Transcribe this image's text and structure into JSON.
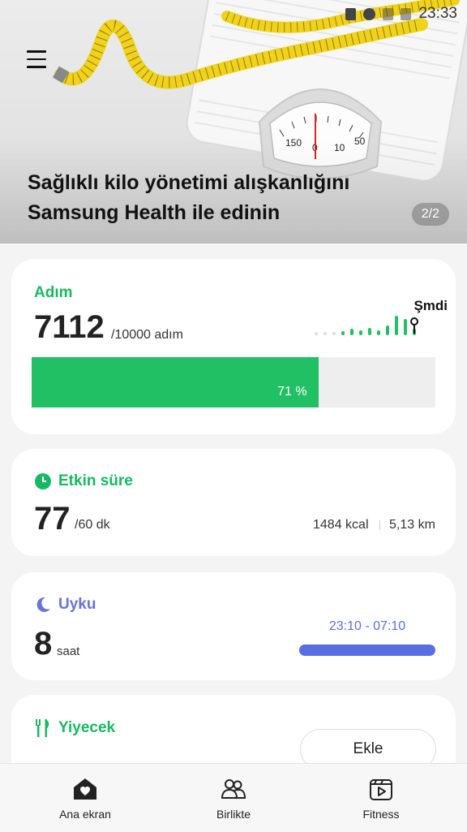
{
  "status_bar": {
    "time": "23:33"
  },
  "banner": {
    "title": "Sağlıklı kilo yönetimi alışkanlığını Samsung Health ile edinin",
    "pager": "2/2"
  },
  "steps": {
    "label": "Adım",
    "value": "7112",
    "goal": "/10000 adım",
    "now_label": "Şmdi",
    "progress_text": "71 %",
    "progress_percent": 71,
    "accent": "#22c064"
  },
  "active": {
    "label": "Etkin süre",
    "value": "77",
    "goal": "/60 dk",
    "kcal": "1484 kcal",
    "distance": "5,13 km"
  },
  "sleep": {
    "label": "Uyku",
    "value": "8",
    "unit": "saat",
    "range": "23:10 - 07:10",
    "accent": "#5b6ee1"
  },
  "food": {
    "label": "Yiyecek",
    "add_label": "Ekle"
  },
  "nav": {
    "home": "Ana ekran",
    "together": "Birlikte",
    "fitness": "Fitness"
  }
}
